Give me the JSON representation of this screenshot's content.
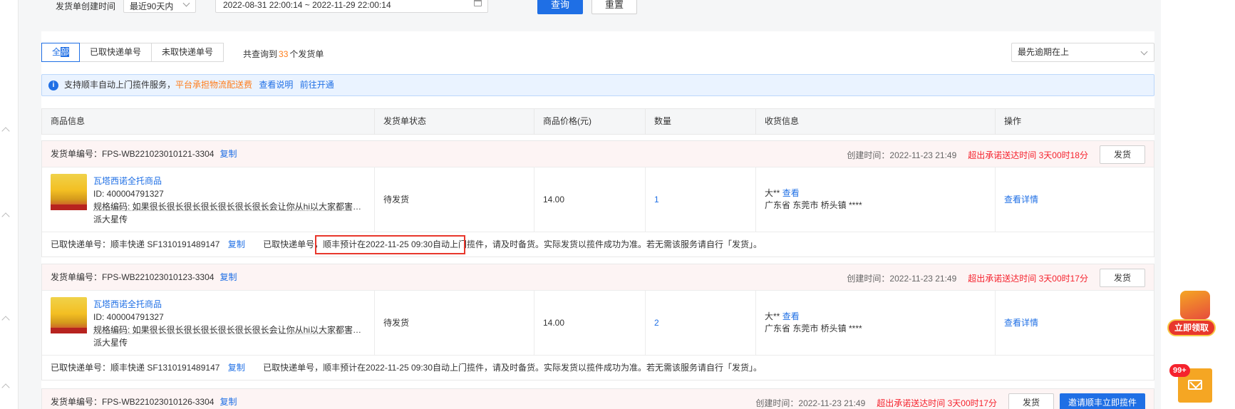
{
  "filter": {
    "label": "发货单创建时间",
    "range_value": "最近90天内",
    "date_range": "2022-08-31 22:00:14 ~ 2022-11-29 22:00:14",
    "query_label": "查询",
    "reset_label": "重置"
  },
  "tabs": {
    "all_prefix": "全",
    "all_highlight": "部",
    "taken": "已取快递单号",
    "not_taken": "未取快递单号"
  },
  "total": {
    "prefix": "共查询到",
    "count": "33",
    "suffix": "个发货单"
  },
  "sort": {
    "value": "最先逾期在上"
  },
  "notice": {
    "text": "支持顺丰自动上门揽件服务，",
    "orange": "平台承担物流配送费",
    "link1": "查看说明",
    "link2": "前往开通"
  },
  "columns": [
    "商品信息",
    "发货单状态",
    "商品价格(元)",
    "数量",
    "收货信息",
    "操作"
  ],
  "orders": [
    {
      "no": "发货单编号：FPS-WB221023010121-3304",
      "copy": "复制",
      "created": "创建时间：2022-11-23 21:49",
      "overdue": "超出承诺送达时间 3天00时18分",
      "ship": "发货",
      "product_title": "瓦塔西诺全托商品",
      "product_id": "ID: 400004791327",
      "product_spec": "规格编码: 如果很长很长很长很长很长很长很长会让你从hi以大家都害怕的",
      "product_extra": "派大星传",
      "status": "待发货",
      "price": "14.00",
      "qty": "1",
      "recv_name": "大**",
      "recv_view": "查看",
      "recv_addr": "广东省 东莞市 桥头镇 ****",
      "op_detail": "查看详情",
      "express": "已取快递单号：顺丰快递   SF1310191489147",
      "express_copy": "复制",
      "express_msg": "已取快递单号，顺丰预计在2022-11-25 09:30自动上门揽件，请及时备货。实际发货以揽件成功为准。若无需该服务请自行「发货」。"
    },
    {
      "no": "发货单编号：FPS-WB221023010123-3304",
      "copy": "复制",
      "created": "创建时间：2022-11-23 21:49",
      "overdue": "超出承诺送达时间 3天00时17分",
      "ship": "发货",
      "product_title": "瓦塔西诺全托商品",
      "product_id": "ID: 400004791327",
      "product_spec": "规格编码: 如果很长很长很长很长很长很长很长会让你从hi以大家都害怕的",
      "product_extra": "派大星传",
      "status": "待发货",
      "price": "14.00",
      "qty": "2",
      "recv_name": "大**",
      "recv_view": "查看",
      "recv_addr": "广东省 东莞市 桥头镇 ****",
      "op_detail": "查看详情",
      "express": "已取快递单号：顺丰快递   SF1310191489147",
      "express_copy": "复制",
      "express_msg": "已取快递单号，顺丰预计在2022-11-25 09:30自动上门揽件，请及时备货。实际发货以揽件成功为准。若无需该服务请自行「发货」。"
    },
    {
      "no": "发货单编号：FPS-WB221023010126-3304",
      "copy": "复制",
      "created": "创建时间：2022-11-23 21:49",
      "overdue": "超出承诺送达时间 3天00时17分",
      "ship": "发货",
      "invite": "邀请顺丰立即揽件"
    }
  ],
  "promo": {
    "label": "立即领取"
  },
  "badge": {
    "count": "99+"
  }
}
